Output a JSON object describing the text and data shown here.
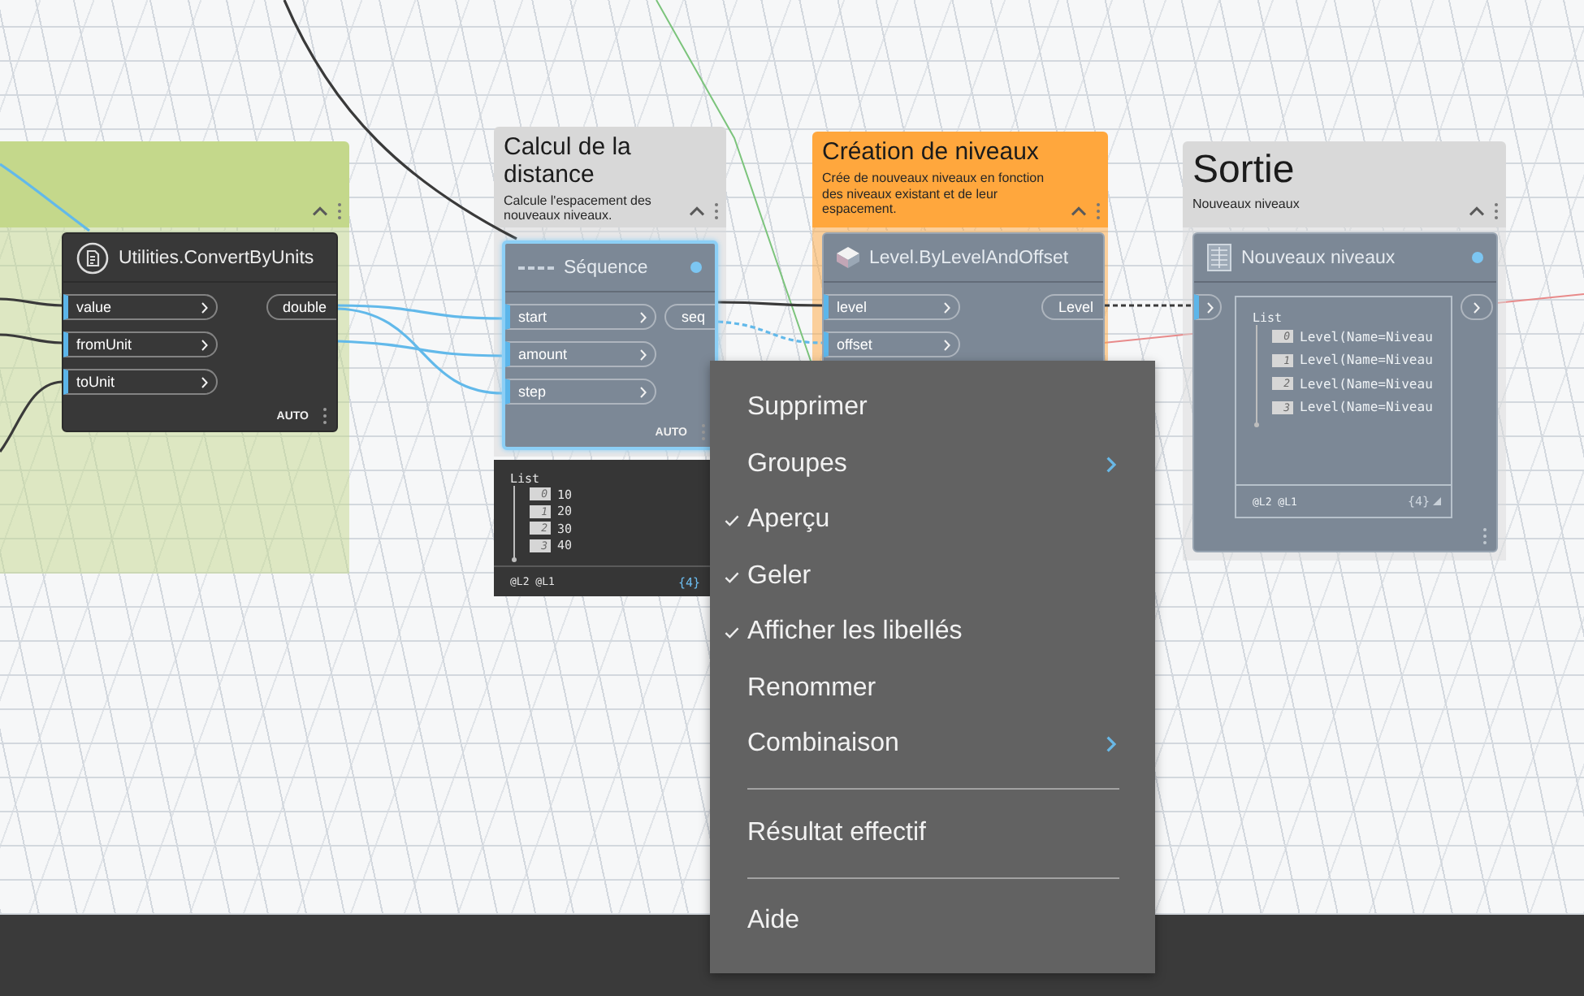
{
  "groups": [
    {
      "color": "#c4d88b",
      "nodes": [
        {
          "kind": "function",
          "title": "Utilities.ConvertByUnits",
          "frozen": false,
          "selected": false,
          "status_dot": false,
          "inputs": [
            {
              "label": "value",
              "connected": true
            },
            {
              "label": "fromUnit",
              "connected": true
            },
            {
              "label": "toUnit",
              "connected": true
            }
          ],
          "outputs": [
            "double"
          ],
          "lacing": "AUTO"
        }
      ]
    },
    {
      "title": "Calcul de la distance",
      "description": "Calcule l'espacement des nouveaux niveaux.",
      "color": "#d8d8d8",
      "nodes": [
        {
          "kind": "function",
          "title": "Séquence",
          "frozen": true,
          "selected": true,
          "status_dot": true,
          "inputs": [
            {
              "label": "start",
              "connected": true
            },
            {
              "label": "amount",
              "connected": true
            },
            {
              "label": "step",
              "connected": true
            }
          ],
          "outputs": [
            "seq"
          ],
          "lacing": "AUTO",
          "preview": {
            "label": "List",
            "items": [
              {
                "index": "0",
                "value": "10"
              },
              {
                "index": "1",
                "value": "20"
              },
              {
                "index": "2",
                "value": "30"
              },
              {
                "index": "3",
                "value": "40"
              }
            ],
            "levels": "@L2 @L1",
            "count": "{4}"
          }
        }
      ]
    },
    {
      "title": "Création de niveaux",
      "description": "Crée de nouveaux niveaux en fonction des niveaux existant et de leur espacement.",
      "color": "#ffa73d",
      "nodes": [
        {
          "kind": "function",
          "title": "Level.ByLevelAndOffset",
          "frozen": true,
          "selected": false,
          "status_dot": false,
          "inputs": [
            {
              "label": "level",
              "connected": true
            },
            {
              "label": "offset",
              "connected": true
            }
          ],
          "outputs": [
            "Level"
          ]
        }
      ]
    },
    {
      "title": "Sortie",
      "description": "Nouveaux niveaux",
      "color": "#d9d9d9",
      "nodes": [
        {
          "kind": "watch",
          "title": "Nouveaux niveaux",
          "frozen": true,
          "selected": false,
          "status_dot": true,
          "inputs": [
            {
              "connected": true
            }
          ],
          "watch": {
            "label": "List",
            "items": [
              {
                "index": "0",
                "value": "Level(Name=Niveau"
              },
              {
                "index": "1",
                "value": "Level(Name=Niveau"
              },
              {
                "index": "2",
                "value": "Level(Name=Niveau"
              },
              {
                "index": "3",
                "value": "Level(Name=Niveau"
              }
            ],
            "levels": "@L2 @L1",
            "count": "{4}"
          }
        }
      ]
    }
  ],
  "context_menu": {
    "items": [
      {
        "kind": "item",
        "label": "Supprimer",
        "checked": false,
        "submenu": false
      },
      {
        "kind": "item",
        "label": "Groupes",
        "checked": false,
        "submenu": true
      },
      {
        "kind": "item",
        "label": "Aperçu",
        "checked": true,
        "submenu": false
      },
      {
        "kind": "item",
        "label": "Geler",
        "checked": true,
        "submenu": false
      },
      {
        "kind": "item",
        "label": "Afficher les libellés",
        "checked": true,
        "submenu": false
      },
      {
        "kind": "item",
        "label": "Renommer",
        "checked": false,
        "submenu": false
      },
      {
        "kind": "item",
        "label": "Combinaison",
        "checked": false,
        "submenu": true
      },
      {
        "kind": "separator"
      },
      {
        "kind": "item",
        "label": "Résultat effectif",
        "checked": false,
        "submenu": false
      },
      {
        "kind": "separator"
      },
      {
        "kind": "item",
        "label": "Aide",
        "checked": false,
        "submenu": false
      }
    ]
  }
}
